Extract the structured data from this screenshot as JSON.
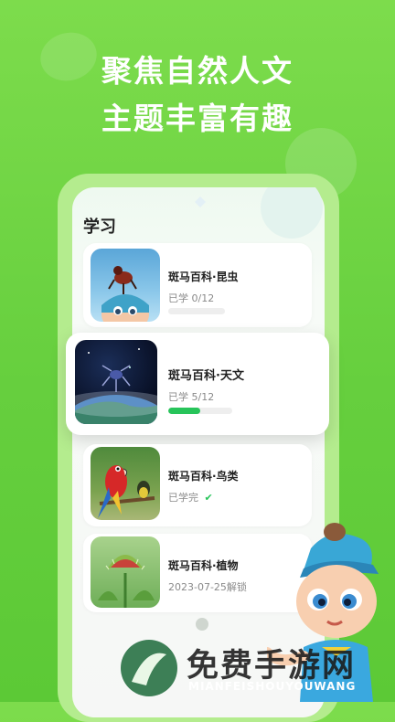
{
  "headline": {
    "line1": "聚焦自然人文",
    "line2": "主题丰富有趣"
  },
  "screen": {
    "title": "学习"
  },
  "courses": [
    {
      "title": "斑马百科·昆虫",
      "status": "已学 0/12",
      "progress": 0,
      "thumb": "insect-icon"
    },
    {
      "title": "斑马百科·天文",
      "status": "已学 5/12",
      "progress": 0.4167,
      "thumb": "earth-icon"
    },
    {
      "title": "斑马百科·鸟类",
      "status": "已学完",
      "status_icon": "check-icon",
      "thumb": "parrot-icon"
    },
    {
      "title": "斑马百科·植物",
      "status": "2023-07-25解锁",
      "thumb": "flytrap-icon"
    }
  ],
  "watermark": {
    "cn": "免费手游网",
    "en": "MIANFEISHOUYOUWANG"
  },
  "colors": {
    "background": "#66cf3e",
    "phone": "#b4ec8e",
    "accent": "#27c45a"
  }
}
